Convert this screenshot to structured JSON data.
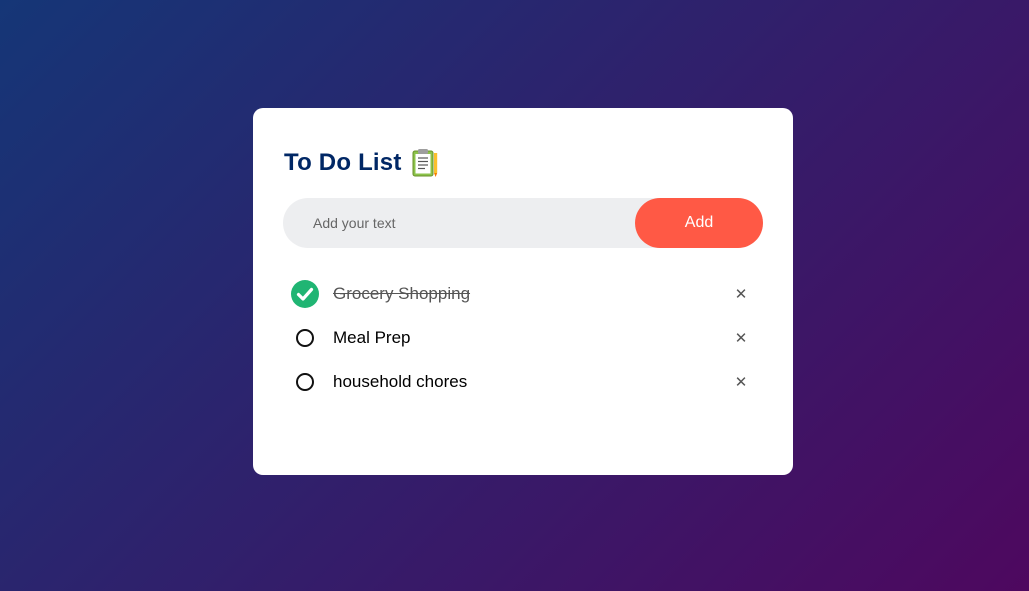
{
  "app": {
    "title": "To Do List",
    "title_icon": "clipboard-notes-icon"
  },
  "input": {
    "value": "",
    "placeholder": "Add your text",
    "add_label": "Add"
  },
  "colors": {
    "accent": "#ff5945",
    "title": "#002765",
    "check_done": "#20b573",
    "gradient_start": "#153677",
    "gradient_end": "#4e085f"
  },
  "tasks": [
    {
      "text": "Grocery Shopping",
      "done": true
    },
    {
      "text": "Meal Prep",
      "done": false
    },
    {
      "text": "household chores",
      "done": false
    }
  ],
  "delete_symbol": "✕"
}
